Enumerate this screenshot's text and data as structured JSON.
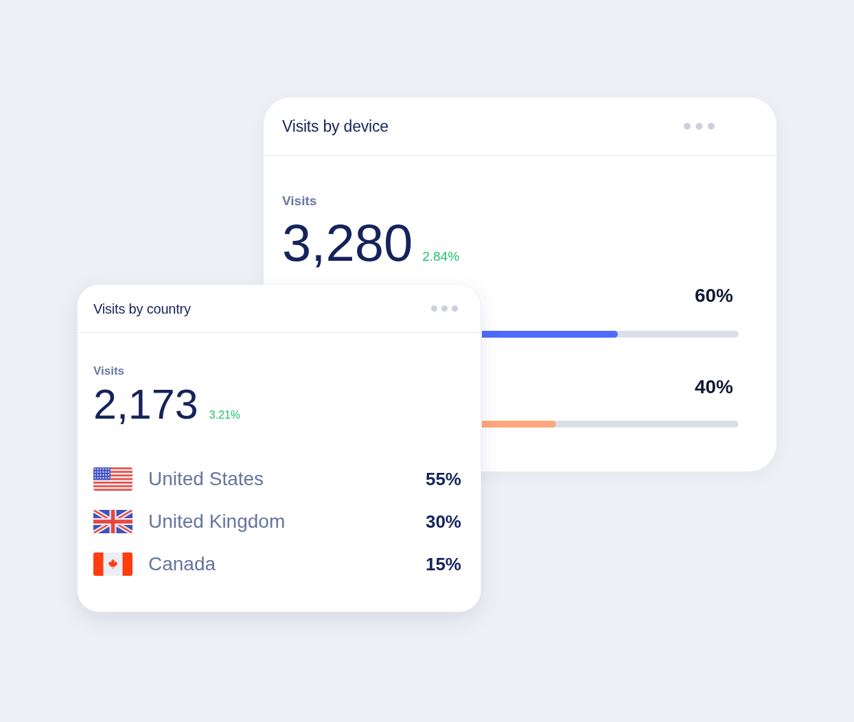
{
  "device_card": {
    "title": "Visits by device",
    "metric_label": "Visits",
    "metric_value": "3,280",
    "change": "2.84%",
    "bars": [
      {
        "reading": "60%",
        "level": 0.53,
        "color": "#4f6bff"
      },
      {
        "reading": "40%",
        "level": 0.29,
        "color": "#ffa77c"
      }
    ]
  },
  "country_card": {
    "title": "Visits by country",
    "metric_label": "Visits",
    "metric_value": "2,173",
    "change": "3.21%",
    "countries": [
      {
        "kind": "us",
        "name": "United States",
        "share": "55%"
      },
      {
        "kind": "uk",
        "name": "United Kingdom",
        "share": "30%"
      },
      {
        "kind": "ca",
        "name": "Canada",
        "share": "15%"
      }
    ]
  }
}
